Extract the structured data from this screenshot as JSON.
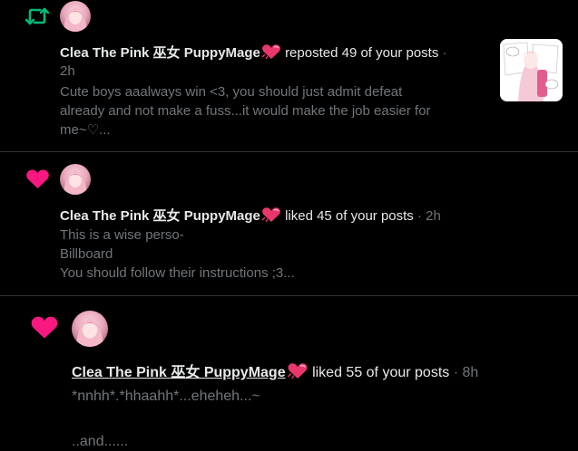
{
  "notifications": [
    {
      "type_icon": "repost-icon",
      "icon_color": "#00ba7c",
      "avatar": "user-avatar",
      "user": "Clea The Pink 巫女 PuppyMage",
      "emoji": "heart-emoji",
      "action": "reposted 49 of your posts",
      "separator": "·",
      "time": "2h",
      "lines": [
        "Cute boys aaalways win <3, you should just admit defeat",
        "already and not make a fuss...it would make the job easier for",
        "me~♡..."
      ],
      "thumbnail": "post-thumbnail"
    },
    {
      "type_icon": "heart-icon",
      "icon_color": "#f91880",
      "avatar": "user-avatar",
      "user": "Clea The Pink 巫女 PuppyMage",
      "emoji": "heart-emoji",
      "action": "liked 45 of your posts",
      "separator": "·",
      "time": "2h",
      "lines": [
        "This is a wise perso-",
        "Billboard",
        "You should follow their instructions ;3..."
      ]
    },
    {
      "type_icon": "heart-icon",
      "icon_color": "#f91880",
      "avatar": "user-avatar",
      "user": "Clea The Pink 巫女 PuppyMage",
      "emoji": "heart-emoji",
      "action": "liked 55 of your posts",
      "separator": "·",
      "time": "8h",
      "lines": [
        "*nnhh*.*hhaahh*...eheheh...~",
        "",
        "..and......"
      ]
    }
  ]
}
